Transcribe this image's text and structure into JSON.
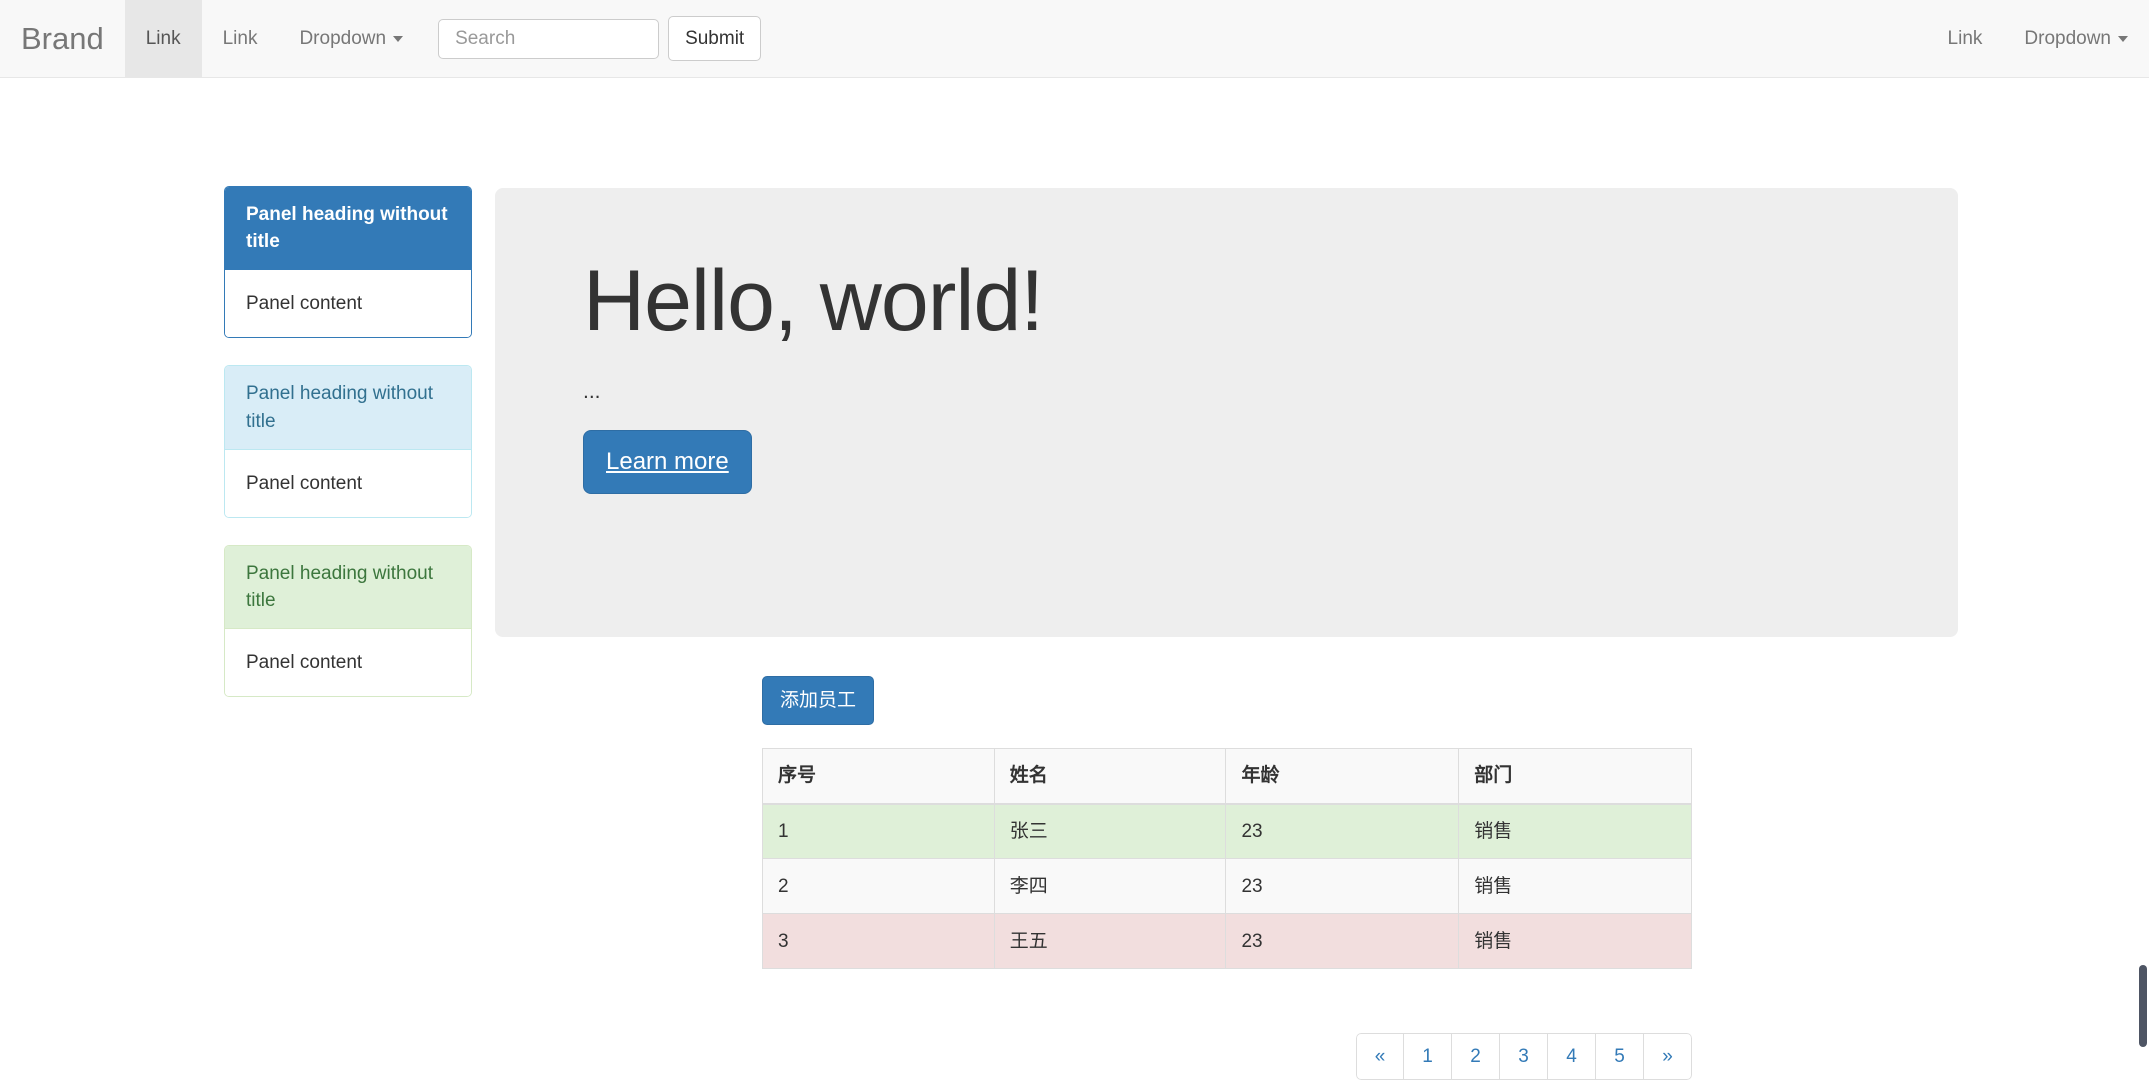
{
  "navbar": {
    "brand": "Brand",
    "left_items": [
      {
        "label": "Link",
        "active": true,
        "dropdown": false
      },
      {
        "label": "Link",
        "active": false,
        "dropdown": false
      },
      {
        "label": "Dropdown",
        "active": false,
        "dropdown": true
      }
    ],
    "search": {
      "value": "",
      "placeholder": "Search"
    },
    "submit_label": "Submit",
    "right_items": [
      {
        "label": "Link",
        "dropdown": false
      },
      {
        "label": "Dropdown",
        "dropdown": true
      }
    ]
  },
  "panels": [
    {
      "style": "primary",
      "heading": "Panel heading without title",
      "body": "Panel content",
      "border_color": "#337ab7",
      "heading_bg": "#337ab7",
      "heading_color": "#ffffff"
    },
    {
      "style": "info",
      "heading": "Panel heading without title",
      "body": "Panel content",
      "border_color": "#bce8f1",
      "heading_bg": "#d9edf7",
      "heading_color": "#31708f"
    },
    {
      "style": "success",
      "heading": "Panel heading without title",
      "body": "Panel content",
      "border_color": "#d6e9c6",
      "heading_bg": "#dff0d8",
      "heading_color": "#3c763d"
    }
  ],
  "jumbotron": {
    "title": "Hello, world!",
    "lead": "...",
    "button_label": "Learn more",
    "bg_color": "#eeeeee"
  },
  "table_section": {
    "add_button_label": "添加员工",
    "columns": [
      "序号",
      "姓名",
      "年龄",
      "部门"
    ],
    "rows": [
      {
        "style": "success",
        "cells": [
          "1",
          "张三",
          "23",
          "销售"
        ]
      },
      {
        "style": "default",
        "cells": [
          "2",
          "李四",
          "23",
          "销售"
        ]
      },
      {
        "style": "danger",
        "cells": [
          "3",
          "王五",
          "23",
          "销售"
        ]
      }
    ],
    "row_colors": {
      "success": "#dff0d8",
      "default": "#f9f9f9",
      "danger": "#f2dede"
    }
  },
  "pagination": {
    "items": [
      "«",
      "1",
      "2",
      "3",
      "4",
      "5",
      "»"
    ],
    "link_color": "#337ab7"
  },
  "theme": {
    "primary": "#337ab7",
    "navbar_bg": "#f8f8f8",
    "navbar_active_bg": "#e7e7e7",
    "text": "#333333",
    "muted": "#777777"
  }
}
